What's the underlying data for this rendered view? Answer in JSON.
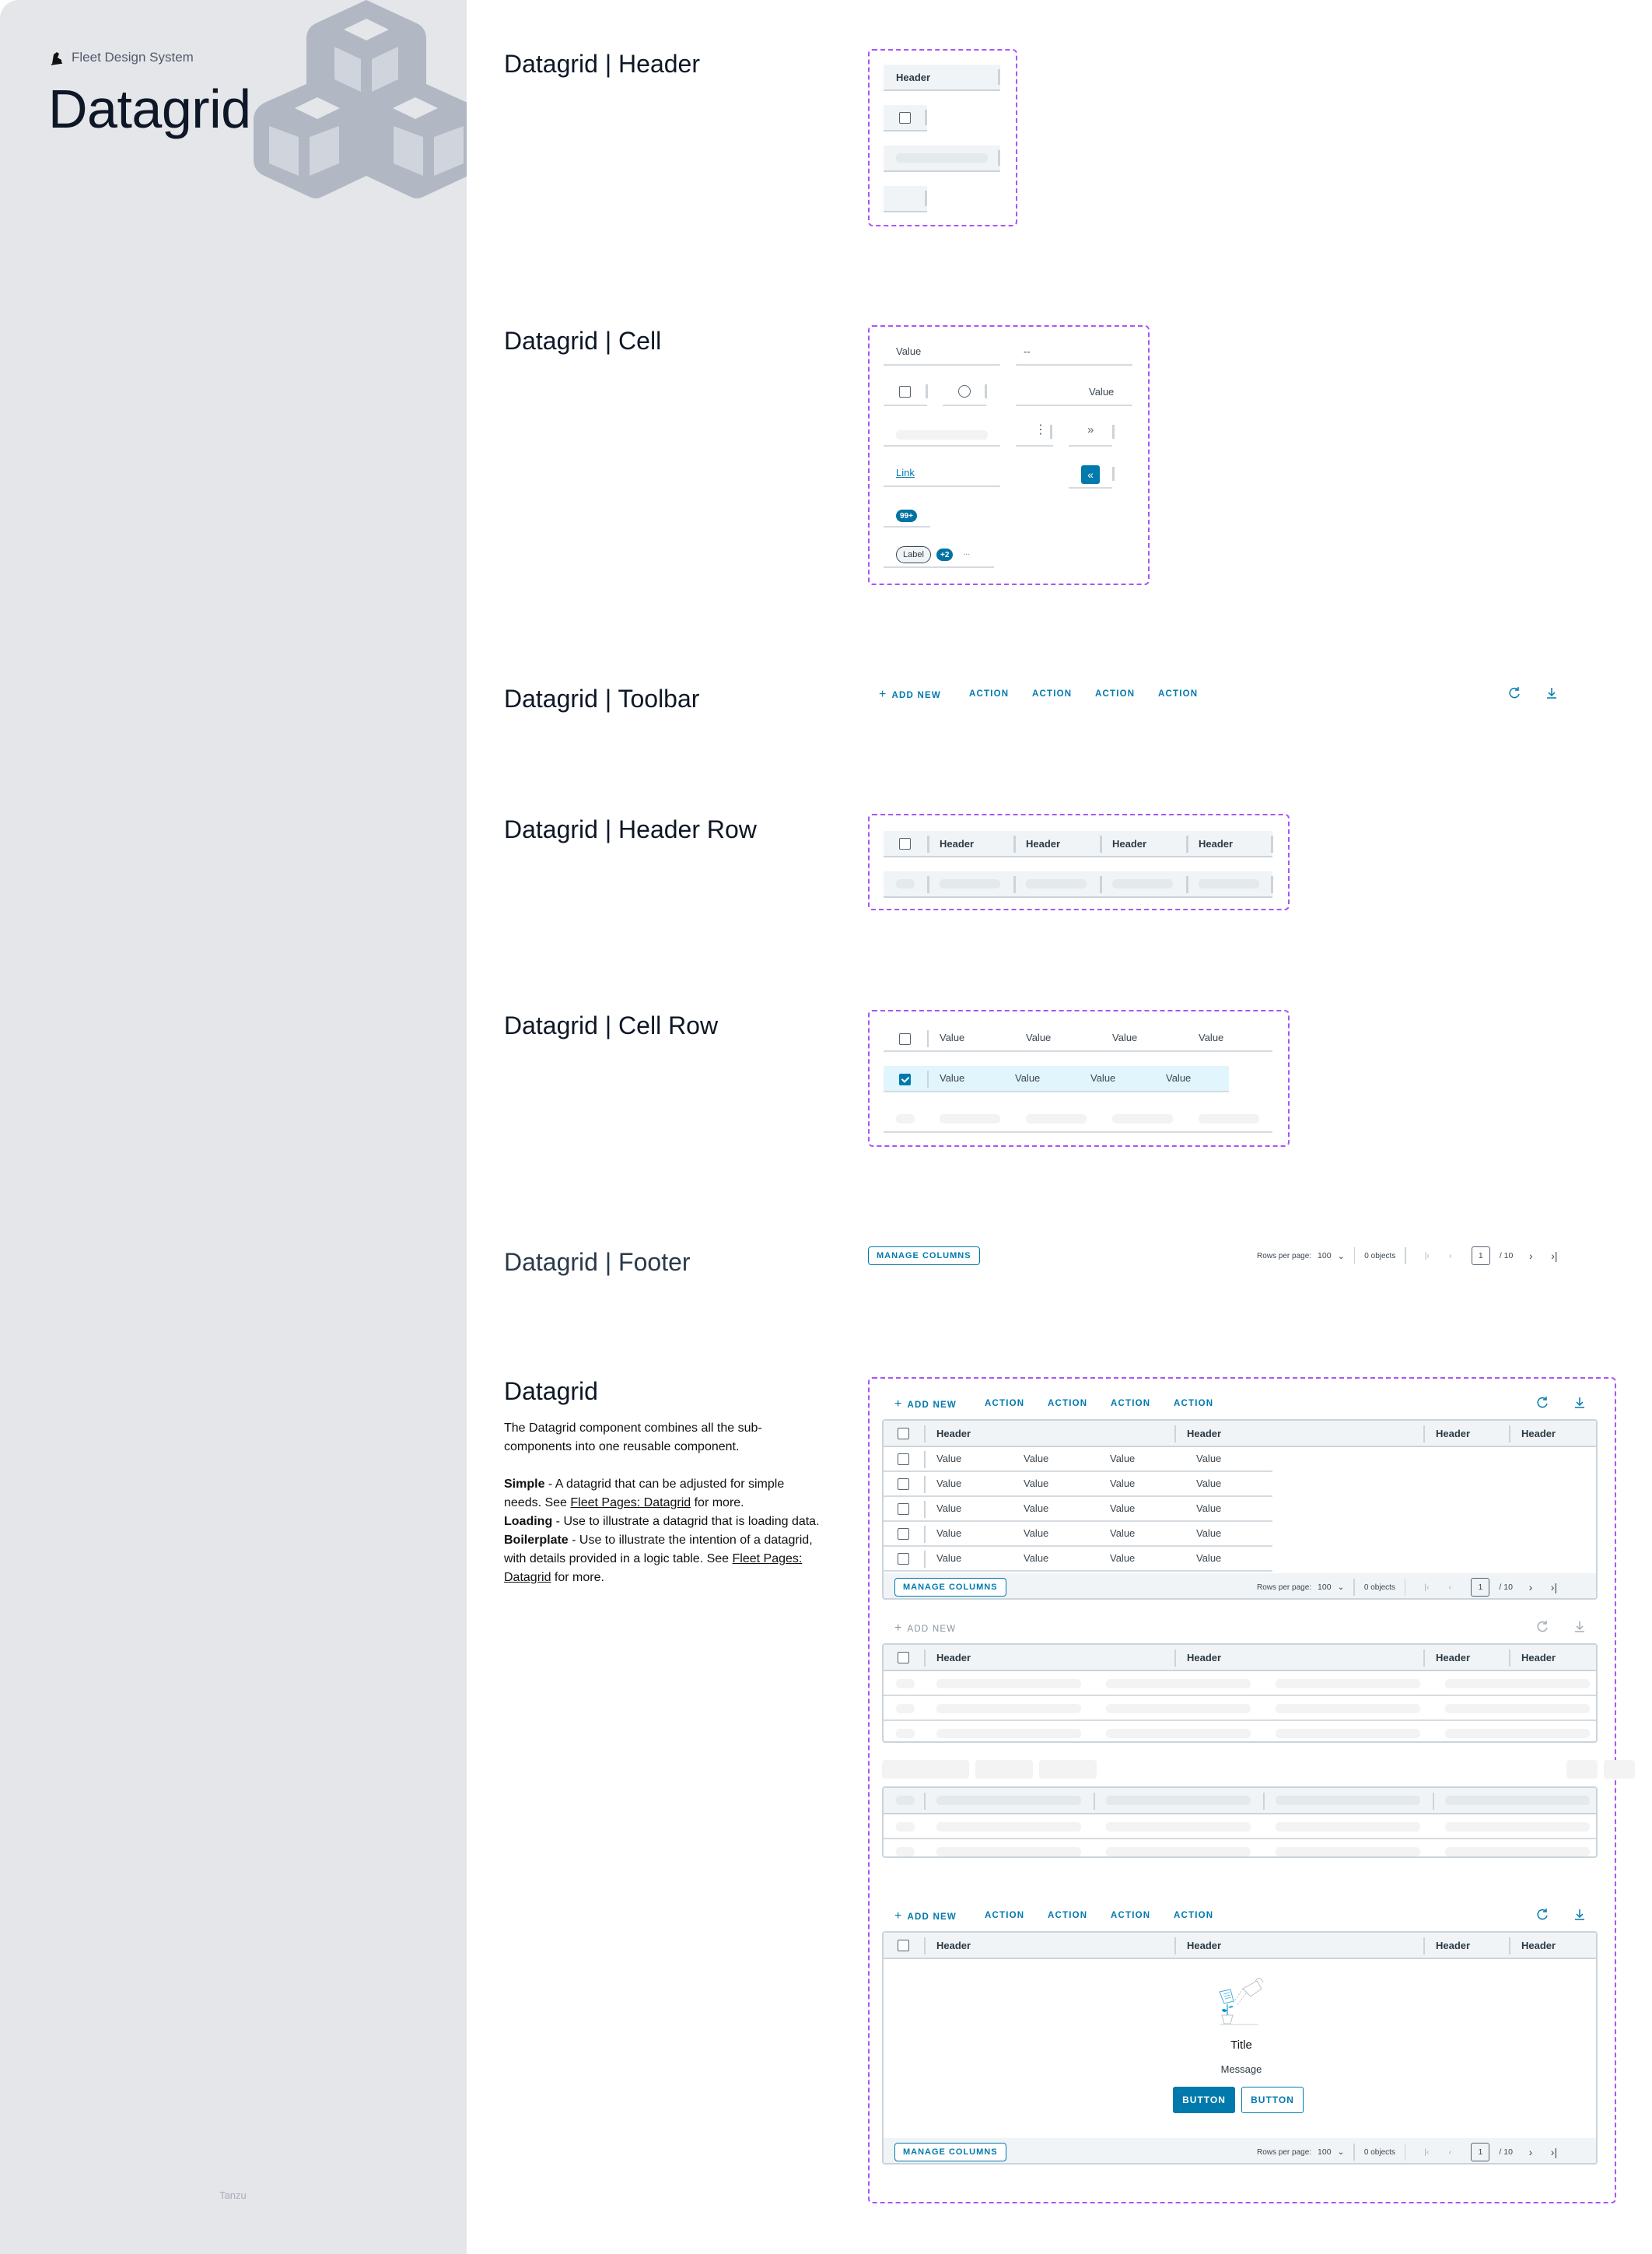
{
  "sidebar": {
    "brand": "Fleet Design System",
    "title": "Datagrid",
    "footer": "Tanzu"
  },
  "sections": {
    "header": "Datagrid | Header",
    "cell": "Datagrid | Cell",
    "toolbar": "Datagrid | Toolbar",
    "header_row": "Datagrid | Header Row",
    "cell_row": "Datagrid | Cell Row",
    "footer": "Datagrid | Footer",
    "datagrid": "Datagrid"
  },
  "header_component": {
    "label": "Header"
  },
  "cell_component": {
    "value": "Value",
    "empty": "--",
    "value_right": "Value",
    "link": "Link",
    "badge": "99+",
    "label": "Label",
    "more_count": "+2",
    "ellipsis": "..."
  },
  "toolbar": {
    "add_new": "ADD NEW",
    "actions": [
      "ACTION",
      "ACTION",
      "ACTION",
      "ACTION"
    ],
    "refresh_icon": "refresh-icon",
    "download_icon": "download-icon"
  },
  "header_row": {
    "headers": [
      "Header",
      "Header",
      "Header",
      "Header"
    ]
  },
  "cell_row": {
    "rows": [
      {
        "checked": false,
        "values": [
          "Value",
          "Value",
          "Value",
          "Value"
        ]
      },
      {
        "checked": true,
        "values": [
          "Value",
          "Value",
          "Value",
          "Value"
        ]
      }
    ]
  },
  "footer": {
    "manage_columns": "MANAGE COLUMNS",
    "rows_per_page_label": "Rows per page:",
    "rows_per_page_value": "100",
    "object_count": "0 objects",
    "current_page": "1",
    "total_pages": "/ 10"
  },
  "description": {
    "intro": "The Datagrid component combines all the sub-components into one reusable component.",
    "items": [
      {
        "term": "Simple",
        "text": " - A datagrid that can be adjusted for simple needs. See ",
        "link": "Fleet Pages: Datagrid",
        "after": " for more."
      },
      {
        "term": "Loading",
        "text": " - Use to illustrate a datagrid that is loading data.",
        "link": "",
        "after": ""
      },
      {
        "term": "Boilerplate",
        "text": " - Use to illustrate the intention of a datagrid, with details provided in a logic table. See ",
        "link": "Fleet Pages: Datagrid",
        "after": " for more."
      }
    ]
  },
  "simple_grid": {
    "headers": [
      "Header",
      "Header",
      "Header",
      "Header"
    ],
    "rows": [
      [
        "Value",
        "Value",
        "Value",
        "Value"
      ],
      [
        "Value",
        "Value",
        "Value",
        "Value"
      ],
      [
        "Value",
        "Value",
        "Value",
        "Value"
      ],
      [
        "Value",
        "Value",
        "Value",
        "Value"
      ],
      [
        "Value",
        "Value",
        "Value",
        "Value"
      ]
    ]
  },
  "loading_grid": {
    "add_new": "ADD NEW",
    "headers": [
      "Header",
      "Header",
      "Header",
      "Header"
    ]
  },
  "boilerplate_grid": {
    "headers": [
      "Header",
      "Header",
      "Header",
      "Header"
    ],
    "empty_title": "Title",
    "empty_message": "Message",
    "primary_button": "BUTTON",
    "secondary_button": "BUTTON"
  },
  "colors": {
    "accent": "#0079ad",
    "frame": "#a855f7",
    "header_bg": "#f0f4f7",
    "selected_row_bg": "#e1f5fd",
    "sidebar_bg": "#e5e6ea"
  }
}
